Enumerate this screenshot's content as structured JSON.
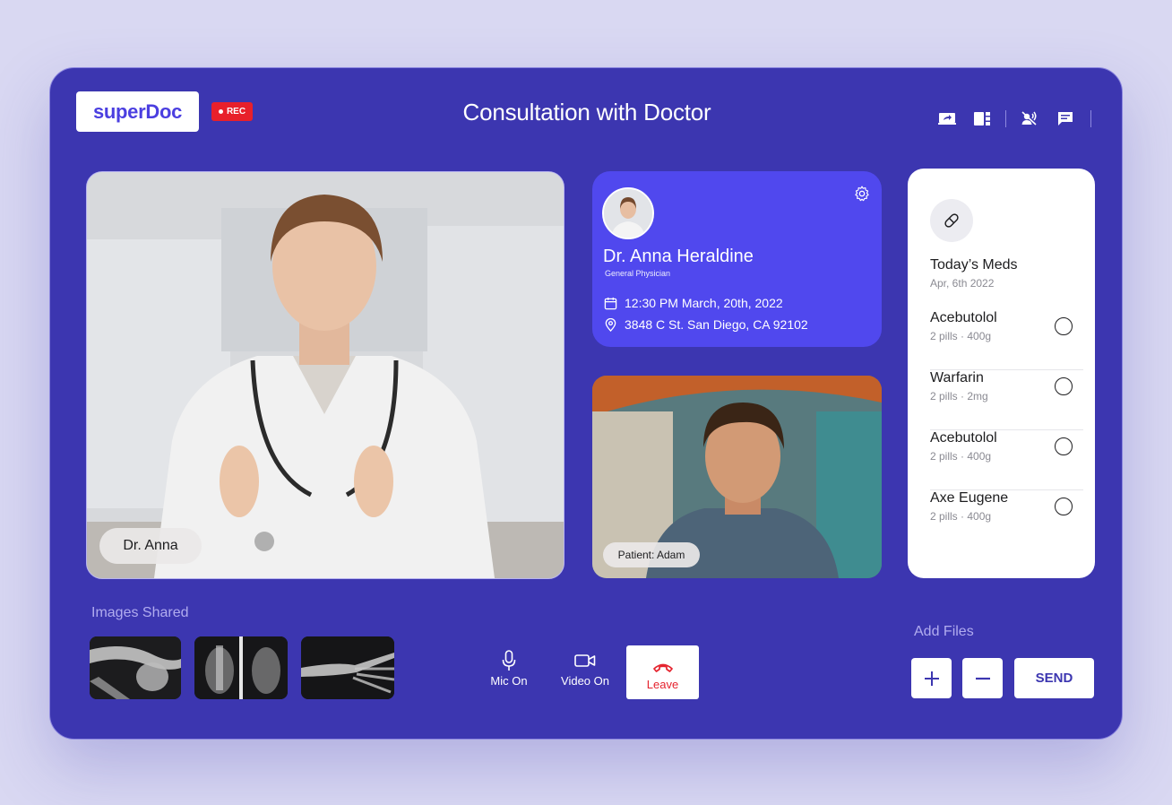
{
  "header": {
    "logo_text": "superDoc",
    "rec_label": "REC",
    "title": "Consultation with Doctor",
    "toolbar_icons": [
      "share-screen-icon",
      "layout-icon",
      "mute-speaker-icon",
      "chat-icon"
    ]
  },
  "main_video": {
    "name_tag": "Dr. Anna"
  },
  "doctor_card": {
    "name": "Dr. Anna Heraldine",
    "role": "General Physician",
    "datetime": "12:30 PM March, 20th, 2022",
    "address": "3848 C St. San Diego, CA 92102"
  },
  "patient_video": {
    "name_tag": "Patient: Adam"
  },
  "meds": {
    "title": "Today’s Meds",
    "date": "Apr, 6th 2022",
    "items": [
      {
        "name": "Acebutolol",
        "dose": "2 pills · 400g"
      },
      {
        "name": "Warfarin",
        "dose": "2 pills · 2mg"
      },
      {
        "name": "Acebutolol",
        "dose": "2 pills · 400g"
      },
      {
        "name": "Axe Eugene",
        "dose": "2 pills · 400g"
      }
    ]
  },
  "images_shared": {
    "label": "Images Shared"
  },
  "controls": {
    "mic_label": "Mic On",
    "video_label": "Video On",
    "leave_label": "Leave"
  },
  "add_files": {
    "label": "Add Files",
    "send_label": "SEND"
  },
  "colors": {
    "background": "#3c36b0",
    "card_accent": "#5048ee",
    "rec_red": "#e8202b",
    "leave_red": "#e5232e"
  }
}
